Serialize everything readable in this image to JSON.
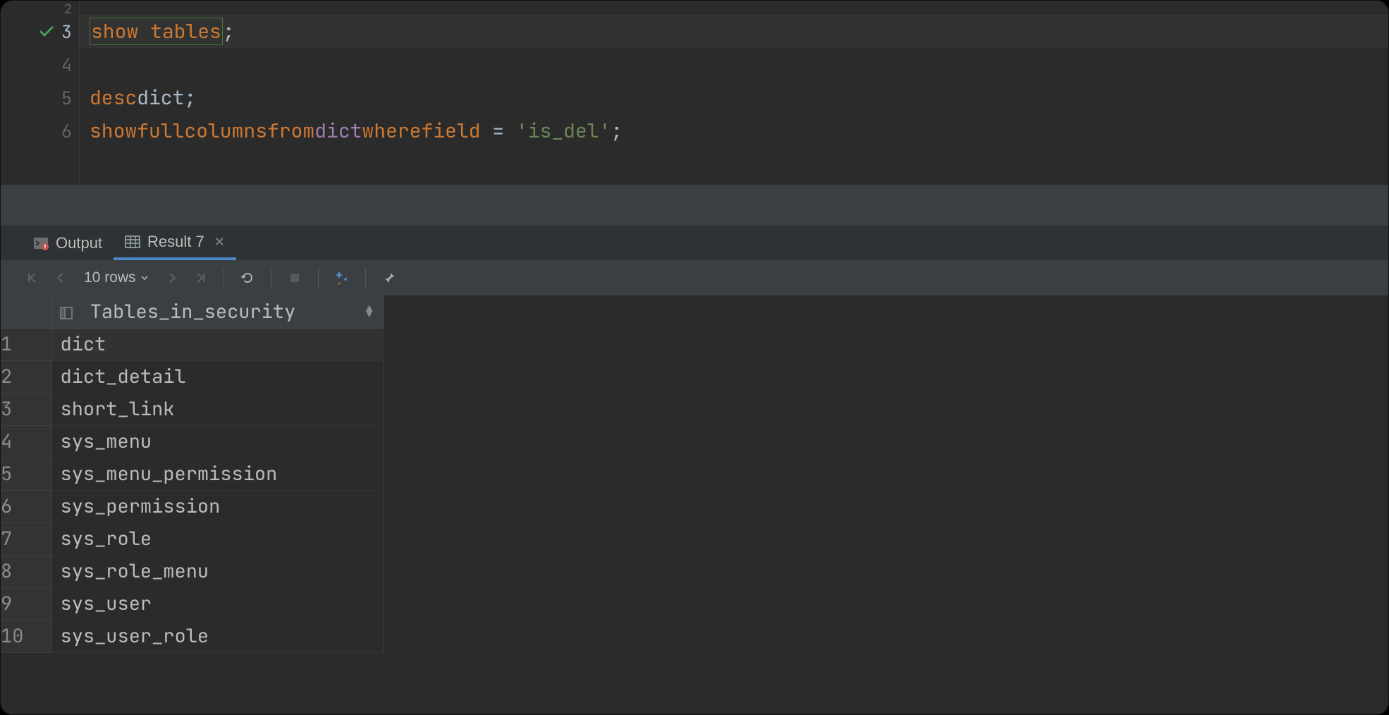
{
  "editor": {
    "lines": [
      {
        "n": 2,
        "tokens": []
      },
      {
        "n": 3,
        "tokens": [
          {
            "t": "show",
            "c": "kw",
            "sel": true
          },
          {
            "t": " "
          },
          {
            "t": "tables",
            "c": "kw",
            "sel": true
          },
          {
            "t": ";",
            "c": "punc"
          }
        ],
        "active": true,
        "check": true
      },
      {
        "n": 4,
        "tokens": []
      },
      {
        "n": 5,
        "tokens": [
          {
            "t": "desc",
            "c": "kw"
          },
          {
            "t": " "
          },
          {
            "t": "dict",
            "c": "id"
          },
          {
            "t": ";",
            "c": "punc"
          }
        ]
      },
      {
        "n": 6,
        "tokens": [
          {
            "t": "show",
            "c": "kw"
          },
          {
            "t": " "
          },
          {
            "t": "full",
            "c": "kw"
          },
          {
            "t": " "
          },
          {
            "t": "columns",
            "c": "kw"
          },
          {
            "t": " "
          },
          {
            "t": "from",
            "c": "kw"
          },
          {
            "t": " "
          },
          {
            "t": "dict",
            "c": "ref"
          },
          {
            "t": " "
          },
          {
            "t": "where",
            "c": "kw"
          },
          {
            "t": " "
          },
          {
            "t": "field",
            "c": "kw"
          },
          {
            "t": " = ",
            "c": "punc"
          },
          {
            "t": "'is_del'",
            "c": "str"
          },
          {
            "t": ";",
            "c": "punc"
          }
        ]
      }
    ]
  },
  "tabs": {
    "output_label": "Output",
    "result_label": "Result 7"
  },
  "toolbar": {
    "rows_label": "10 rows"
  },
  "results": {
    "column": "Tables_in_security",
    "rows": [
      "dict",
      "dict_detail",
      "short_link",
      "sys_menu",
      "sys_menu_permission",
      "sys_permission",
      "sys_role",
      "sys_role_menu",
      "sys_user",
      "sys_user_role"
    ],
    "selected_index": 0
  }
}
